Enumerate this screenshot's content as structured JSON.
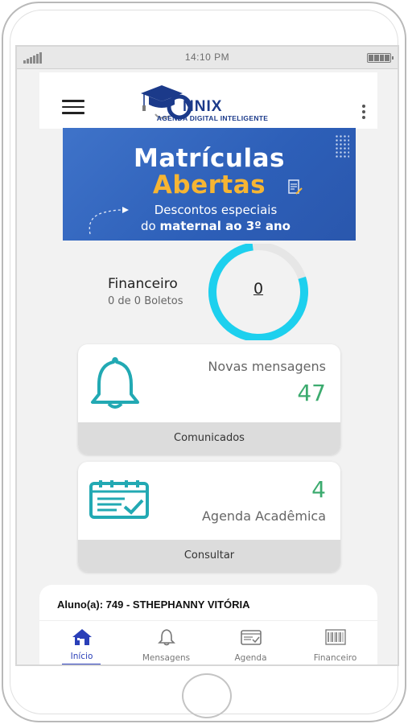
{
  "status_bar": {
    "time": "14:10 PM"
  },
  "header": {
    "logo_word": "NNIX",
    "logo_tagline": "AGENDA DIGITAL INTELIGENTE",
    "menu_icon": "hamburger-icon",
    "more_icon": "kebab-icon"
  },
  "banner": {
    "line1": "Matrículas",
    "line2": "Abertas",
    "line3": "Descontos especiais",
    "line4_prefix": "do ",
    "line4_bold": "maternal ao 3º ano"
  },
  "financeiro": {
    "title": "Financeiro",
    "subtitle": "0 de 0 Boletos",
    "value": "0",
    "progress_fraction": 0.78
  },
  "cards": {
    "messages": {
      "label": "Novas mensagens",
      "count": "47",
      "footer": "Comunicados",
      "icon": "bell-icon"
    },
    "agenda": {
      "label": "Agenda Acadêmica",
      "count": "4",
      "footer": "Consultar",
      "icon": "calendar-check-icon"
    }
  },
  "student": {
    "label": "Aluno(a): 749 - STHEPHANNY VITÓRIA"
  },
  "tabs": [
    {
      "label": "Início",
      "icon": "home-icon",
      "active": true
    },
    {
      "label": "Mensagens",
      "icon": "bell-icon",
      "active": false
    },
    {
      "label": "Agenda",
      "icon": "calendar-icon",
      "active": false
    },
    {
      "label": "Financeiro",
      "icon": "barcode-icon",
      "active": false
    }
  ],
  "colors": {
    "accent": "#2a3fb8",
    "teal": "#22a9b3",
    "green": "#3cab6f",
    "donut": "#1dd0ee",
    "banner_blue": "#2d5fb8",
    "banner_yellow": "#f6b533"
  }
}
